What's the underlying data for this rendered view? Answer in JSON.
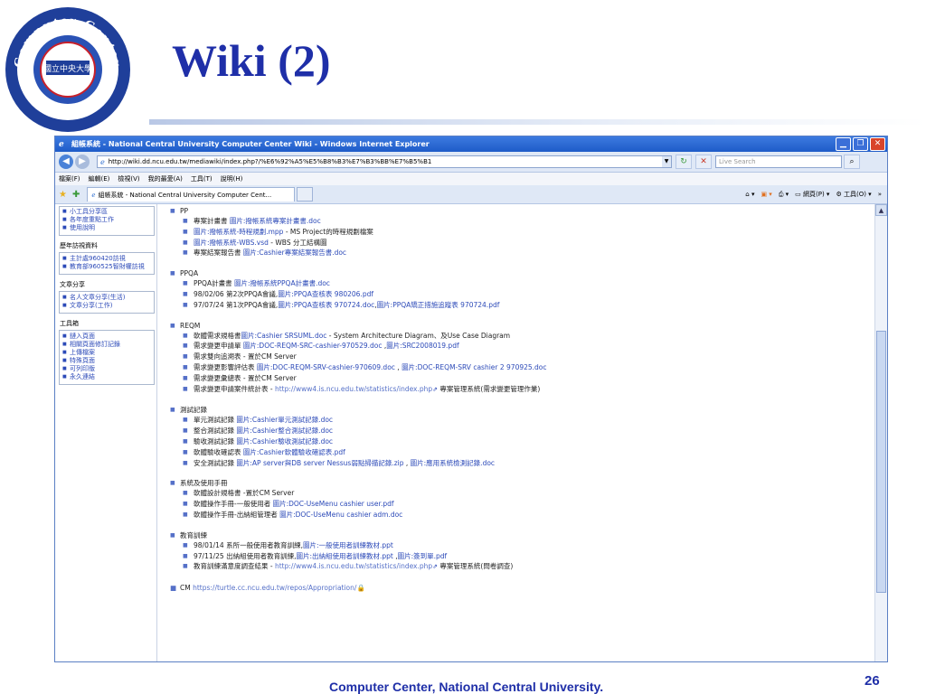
{
  "slide": {
    "title": "Wiki (2)",
    "footer": "Computer Center, National Central University.",
    "page_number": "26",
    "logo": {
      "top_text": "Computer Center",
      "bottom_text": "www.cc.ncu.edu.tw",
      "center_text": "國立中央大學"
    }
  },
  "browser": {
    "title": "組帳系統 - National Central University Computer Center Wiki - Windows Internet Explorer",
    "address": "http://wiki.dd.ncu.edu.tw/mediawiki/index.php?/%E6%92%A5%E5%B8%B3%E7%B3%BB%E7%B5%B1",
    "search_placeholder": "Live Search",
    "menu": [
      "檔案(F)",
      "編輯(E)",
      "檢視(V)",
      "我的最愛(A)",
      "工具(T)",
      "說明(H)"
    ],
    "tab_label": "組帳系統 - National Central University Computer Cent...",
    "cmd_page": "網頁(P)",
    "cmd_tools": "工具(O)"
  },
  "sidebar": {
    "first_items": [
      "小工具分享區",
      "各年度重點工作",
      "使用說明"
    ],
    "portlets": [
      {
        "title": "歷年訪視資料",
        "items": [
          "主計處960420訪視",
          "教育部960525智財權訪視"
        ]
      },
      {
        "title": "文章分享",
        "items": [
          "名人文章分享(生活)",
          "文章分享(工作)"
        ]
      },
      {
        "title": "工具箱",
        "items": [
          "鏈入頁面",
          "相關頁面修訂記錄",
          "上傳檔案",
          "特殊頁面",
          "可列印版",
          "永久連結"
        ]
      }
    ]
  },
  "content": {
    "sections": [
      {
        "title": "PP",
        "items": [
          [
            {
              "t": "專案計畫書 "
            },
            {
              "t": "圖片:撥帳系統專案計畫書.doc",
              "link": true
            }
          ],
          [
            {
              "t": "圖片:撥帳系統-時程規劃.mpp",
              "link": true
            },
            {
              "t": " - MS Project的時程規劃檔案"
            }
          ],
          [
            {
              "t": "圖片:撥帳系統-WBS.vsd",
              "link": true
            },
            {
              "t": " - WBS 分工結構圖"
            }
          ],
          [
            {
              "t": "專案結案報告書 "
            },
            {
              "t": "圖片:Cashier專案結案報告書.doc",
              "link": true
            }
          ]
        ]
      },
      {
        "title": "PPQA",
        "items": [
          [
            {
              "t": "PPQA計畫書 "
            },
            {
              "t": "圖片:撥帳系統PPQA計畫書.doc",
              "link": true
            }
          ],
          [
            {
              "t": "98/02/06 第2次PPQA會議,"
            },
            {
              "t": "圖片:PPQA查核表 980206.pdf",
              "link": true
            }
          ],
          [
            {
              "t": "97/07/24 第1次PPQA會議,"
            },
            {
              "t": "圖片:PPQA查核表 970724.doc",
              "link": true
            },
            {
              "t": ","
            },
            {
              "t": "圖片:PPQA矯正措施追蹤表 970724.pdf",
              "link": true
            }
          ]
        ]
      },
      {
        "title": "REQM",
        "items": [
          [
            {
              "t": "軟體需求規格書"
            },
            {
              "t": "圖片:Cashier SRSUML.doc",
              "link": true
            },
            {
              "t": " - System Architecture Diagram、及Use Case Diagram"
            }
          ],
          [
            {
              "t": "需求變更申請單 "
            },
            {
              "t": "圖片:DOC-REQM-SRC-cashier-970529.doc",
              "link": true
            },
            {
              "t": " ,"
            },
            {
              "t": "圖片:SRC2008019.pdf",
              "link": true
            }
          ],
          [
            {
              "t": "需求雙向追溯表 - 置於CM Server"
            }
          ],
          [
            {
              "t": "需求變更影響評估表 "
            },
            {
              "t": "圖片:DOC-REQM-SRV-cashier-970609.doc",
              "link": true
            },
            {
              "t": " , "
            },
            {
              "t": "圖片:DOC-REQM-SRV cashier 2 970925.doc",
              "link": true
            }
          ],
          [
            {
              "t": "需求變更彙總表 - 置於CM Server"
            }
          ],
          [
            {
              "t": "需求變更申請案件統計表 - "
            },
            {
              "t": "http://www4.is.ncu.edu.tw/statistics/index.php",
              "ext": true
            },
            {
              "t": "⇗",
              "icon": true
            },
            {
              "t": " 專案管理系統(需求變更管理作業)"
            }
          ]
        ]
      },
      {
        "title": "測試記錄",
        "items": [
          [
            {
              "t": "單元測試記錄 "
            },
            {
              "t": "圖片:Cashier單元測試記錄.doc",
              "link": true
            }
          ],
          [
            {
              "t": "整合測試記錄 "
            },
            {
              "t": "圖片:Cashier整合測試記錄.doc",
              "link": true
            }
          ],
          [
            {
              "t": "驗收測試記錄 "
            },
            {
              "t": "圖片:Cashier驗收測試記錄.doc",
              "link": true
            }
          ],
          [
            {
              "t": "軟體驗收確認表 "
            },
            {
              "t": "圖片:Cashier軟體驗收確認表.pdf",
              "link": true
            }
          ],
          [
            {
              "t": "安全測試記錄 "
            },
            {
              "t": "圖片:AP server與DB server Nessus弱點掃描記錄.zip",
              "link": true
            },
            {
              "t": " , "
            },
            {
              "t": "圖片:應用系統檢測記錄.doc",
              "link": true
            }
          ]
        ]
      },
      {
        "title": "系統及使用手冊",
        "items": [
          [
            {
              "t": "軟體設計規格書 -置於CM Server"
            }
          ],
          [
            {
              "t": "軟體操作手冊-一般使用者 "
            },
            {
              "t": "圖片:DOC-UseMenu cashier user.pdf",
              "link": true
            }
          ],
          [
            {
              "t": "軟體操作手冊-出納組管理者 "
            },
            {
              "t": "圖片:DOC-UseMenu cashier adm.doc",
              "link": true
            }
          ]
        ]
      },
      {
        "title": "教育訓練",
        "items": [
          [
            {
              "t": "98/01/14 系所一般使用者教育訓練,"
            },
            {
              "t": "圖片:一般使用者訓練教材.ppt",
              "link": true
            }
          ],
          [
            {
              "t": "97/11/25 出納組使用者教育訓練,"
            },
            {
              "t": "圖片:出納組使用者訓練教材.ppt",
              "link": true
            },
            {
              "t": " ,"
            },
            {
              "t": "圖片:簽到單.pdf",
              "link": true
            }
          ],
          [
            {
              "t": "教育訓練滿意度調查結果 - "
            },
            {
              "t": "http://www4.is.ncu.edu.tw/statistics/index.php",
              "ext": true
            },
            {
              "t": "⇗",
              "icon": true
            },
            {
              "t": " 專案管理系統(問卷調查)"
            }
          ]
        ]
      }
    ],
    "cm_label": "CM ",
    "cm_link": "https://turtle.cc.ncu.edu.tw/repos/Appropriation/",
    "cm_icon": "🔒"
  }
}
